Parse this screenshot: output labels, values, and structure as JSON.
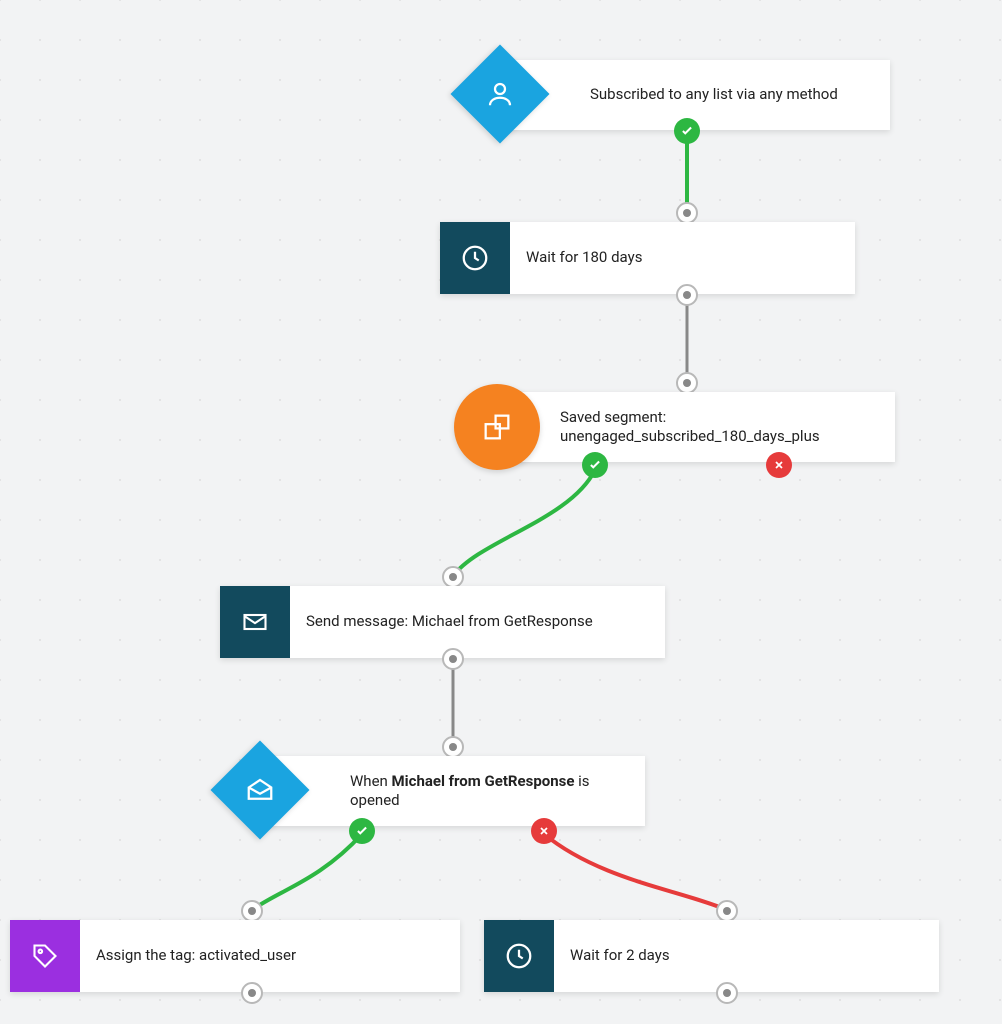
{
  "colors": {
    "blue": "#1aa4e0",
    "teal": "#124a5d",
    "orange": "#f58220",
    "purple": "#9b2fe0",
    "green": "#2db742",
    "red": "#e63b3b"
  },
  "nodes": {
    "trigger": {
      "text": "Subscribed to any list via any method",
      "icon": "user-icon",
      "shape": "diamond-blue"
    },
    "wait180": {
      "text": "Wait for 180 days",
      "icon": "clock-icon",
      "shape": "square-teal"
    },
    "segment": {
      "text": "Saved segment: unengaged_subscribed_180_days_plus",
      "icon": "segment-icon",
      "shape": "circle-orange"
    },
    "send": {
      "text_prefix": "Send message: ",
      "text_value": "Michael from GetResponse",
      "icon": "mail-icon",
      "shape": "square-teal"
    },
    "opened": {
      "text_prefix": "When ",
      "text_bold": "Michael from GetResponse",
      "text_suffix": " is opened",
      "icon": "open-mail-icon",
      "shape": "diamond-blue"
    },
    "assign": {
      "text": "Assign the tag: activated_user",
      "icon": "tag-icon",
      "shape": "square-purple"
    },
    "wait2": {
      "text": "Wait for 2 days",
      "icon": "clock-icon",
      "shape": "square-teal"
    }
  }
}
